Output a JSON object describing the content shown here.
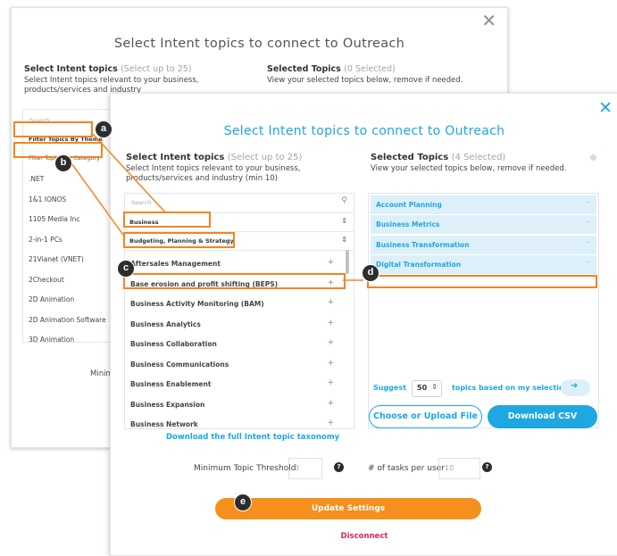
{
  "back_modal": {
    "title": "Select Intent topics to connect to Outreach",
    "left_heading": "Select Intent topics",
    "left_heading_note": "(Select up to 25)",
    "left_desc": "Select Intent topics relevant to your business, products/services and industry",
    "right_heading": "Selected Topics",
    "right_heading_note": "(0 Selected)",
    "right_desc": "View your selected topics below, remove if needed.",
    "search_placeholder": "Search",
    "filter_theme": "Filter Topics By Theme",
    "filter_category": "Filter Topics By Category",
    "items": [
      ".NET",
      "1&1 IONOS",
      "1105 Media Inc",
      "2-in-1 PCs",
      "21Vianet (VNET)",
      "2Checkout",
      "2D Animation",
      "2D Animation Software",
      "3D Animation"
    ],
    "minimum_partial": "Minim"
  },
  "front_modal": {
    "title": "Select Intent topics to connect to Outreach",
    "left_heading": "Select Intent topics",
    "left_heading_note": "(Select up to 25)",
    "left_desc": "Select Intent topics relevant to your business, products/services and industry (min 10)",
    "right_heading": "Selected Topics",
    "right_heading_note": "(4 Selected)",
    "right_desc": "View your selected topics below, remove if needed.",
    "search_placeholder": "Search",
    "filter_theme_value": "Business",
    "filter_category_value": "Budgeting, Planning & Strategy",
    "topics": [
      "Aftersales Management",
      "Base erosion and profit shifting (BEPS)",
      "Business Activity Monitoring (BAM)",
      "Business Analytics",
      "Business Collaboration",
      "Business Communications",
      "Business Enablement",
      "Business Expansion",
      "Business Network"
    ],
    "selected_topics": [
      "Account Planning",
      "Business Metrics",
      "Business Transformation",
      "Digital Transformation"
    ],
    "suggest_label": "Suggest",
    "suggest_value": "50",
    "suggest_after": "topics based on my selection",
    "upload_button": "Choose or Upload File",
    "csv_button": "Download CSV",
    "download_link": "Download the full Intent topic taxonomy",
    "threshold_label": "Minimum Topic Threshold",
    "threshold_value": "3",
    "tasks_label": "# of tasks per user",
    "tasks_value": "10",
    "update_button": "Update Settings",
    "disconnect": "Disconnect"
  },
  "annotations": {
    "a": "a",
    "b": "b",
    "c": "c",
    "d": "d",
    "e": "e",
    "color": "#f5841f"
  },
  "colors": {
    "accent": "#1ea7e1",
    "update": "#f5901e",
    "disconnect": "#e0245e",
    "selected_bg": "#ddf0fa"
  }
}
